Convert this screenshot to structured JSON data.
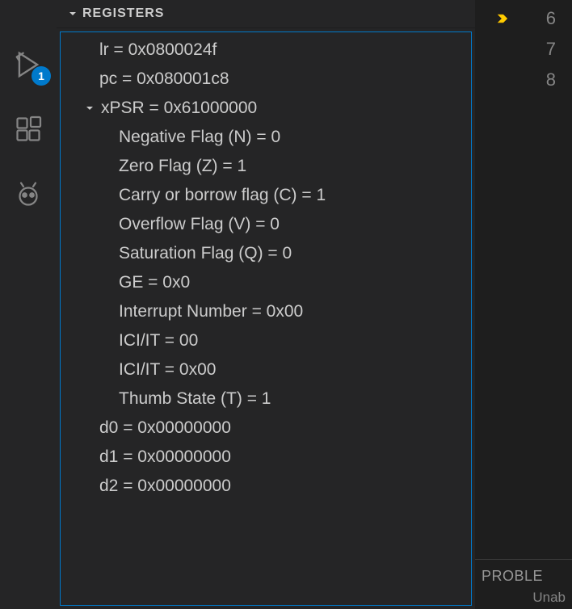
{
  "activity_bar": {
    "run_badge": "1"
  },
  "section": {
    "title": "REGISTERS"
  },
  "registers": {
    "lr": "lr = 0x0800024f",
    "pc": "pc = 0x080001c8",
    "xpsr": {
      "header": "xPSR = 0x61000000",
      "flags": {
        "n": "Negative Flag (N) = 0",
        "z": "Zero Flag (Z) = 1",
        "c": "Carry or borrow flag (C) = 1",
        "v": "Overflow Flag (V) = 0",
        "q": "Saturation Flag (Q) = 0",
        "ge": "GE = 0x0",
        "interrupt": "Interrupt Number = 0x00",
        "ici1": "ICI/IT = 00",
        "ici2": "ICI/IT = 0x00",
        "thumb": "Thumb State (T) = 1"
      }
    },
    "d0": "d0 = 0x00000000",
    "d1": "d1 = 0x00000000",
    "d2": "d2 = 0x00000000"
  },
  "editor": {
    "lines": [
      "6",
      "7",
      "8"
    ]
  },
  "bottom": {
    "problems": "PROBLE",
    "unab": "Unab"
  }
}
